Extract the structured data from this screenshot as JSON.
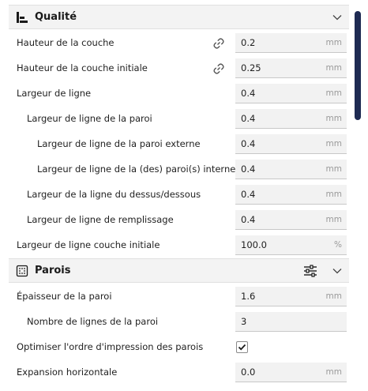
{
  "sections": {
    "quality": {
      "title": "Qualité",
      "icon": "quality-bars-icon"
    },
    "walls": {
      "title": "Parois",
      "icon": "walls-grid-icon",
      "settings_icon": "sliders-icon"
    }
  },
  "quality_rows": {
    "layer_height": {
      "label": "Hauteur de la couche",
      "value": "0.2",
      "unit": "mm",
      "linked": true
    },
    "initial_layer_height": {
      "label": "Hauteur de la couche initiale",
      "value": "0.25",
      "unit": "mm",
      "linked": true
    },
    "line_width": {
      "label": "Largeur de ligne",
      "value": "0.4",
      "unit": "mm"
    },
    "wall_line_width": {
      "label": "Largeur de ligne de la paroi",
      "value": "0.4",
      "unit": "mm"
    },
    "outer_wall_line_width": {
      "label": "Largeur de ligne de la paroi externe",
      "value": "0.4",
      "unit": "mm"
    },
    "inner_wall_line_width": {
      "label": "Largeur de ligne de la (des) paroi(s) interne(s)",
      "value": "0.4",
      "unit": "mm"
    },
    "top_bottom_line_width": {
      "label": "Largeur de la ligne du dessus/dessous",
      "value": "0.4",
      "unit": "mm"
    },
    "infill_line_width": {
      "label": "Largeur de ligne de remplissage",
      "value": "0.4",
      "unit": "mm"
    },
    "initial_layer_line_width": {
      "label": "Largeur de ligne couche initiale",
      "value": "100.0",
      "unit": "%"
    }
  },
  "wall_rows": {
    "wall_thickness": {
      "label": "Épaisseur de la paroi",
      "value": "1.6",
      "unit": "mm"
    },
    "wall_line_count": {
      "label": "Nombre de lignes de la paroi",
      "value": "3",
      "unit": ""
    },
    "optimize_wall_order": {
      "label": "Optimiser l'ordre d'impression des parois",
      "checked": true
    },
    "horizontal_expansion": {
      "label": "Expansion horizontale",
      "value": "0.0",
      "unit": "mm"
    }
  }
}
